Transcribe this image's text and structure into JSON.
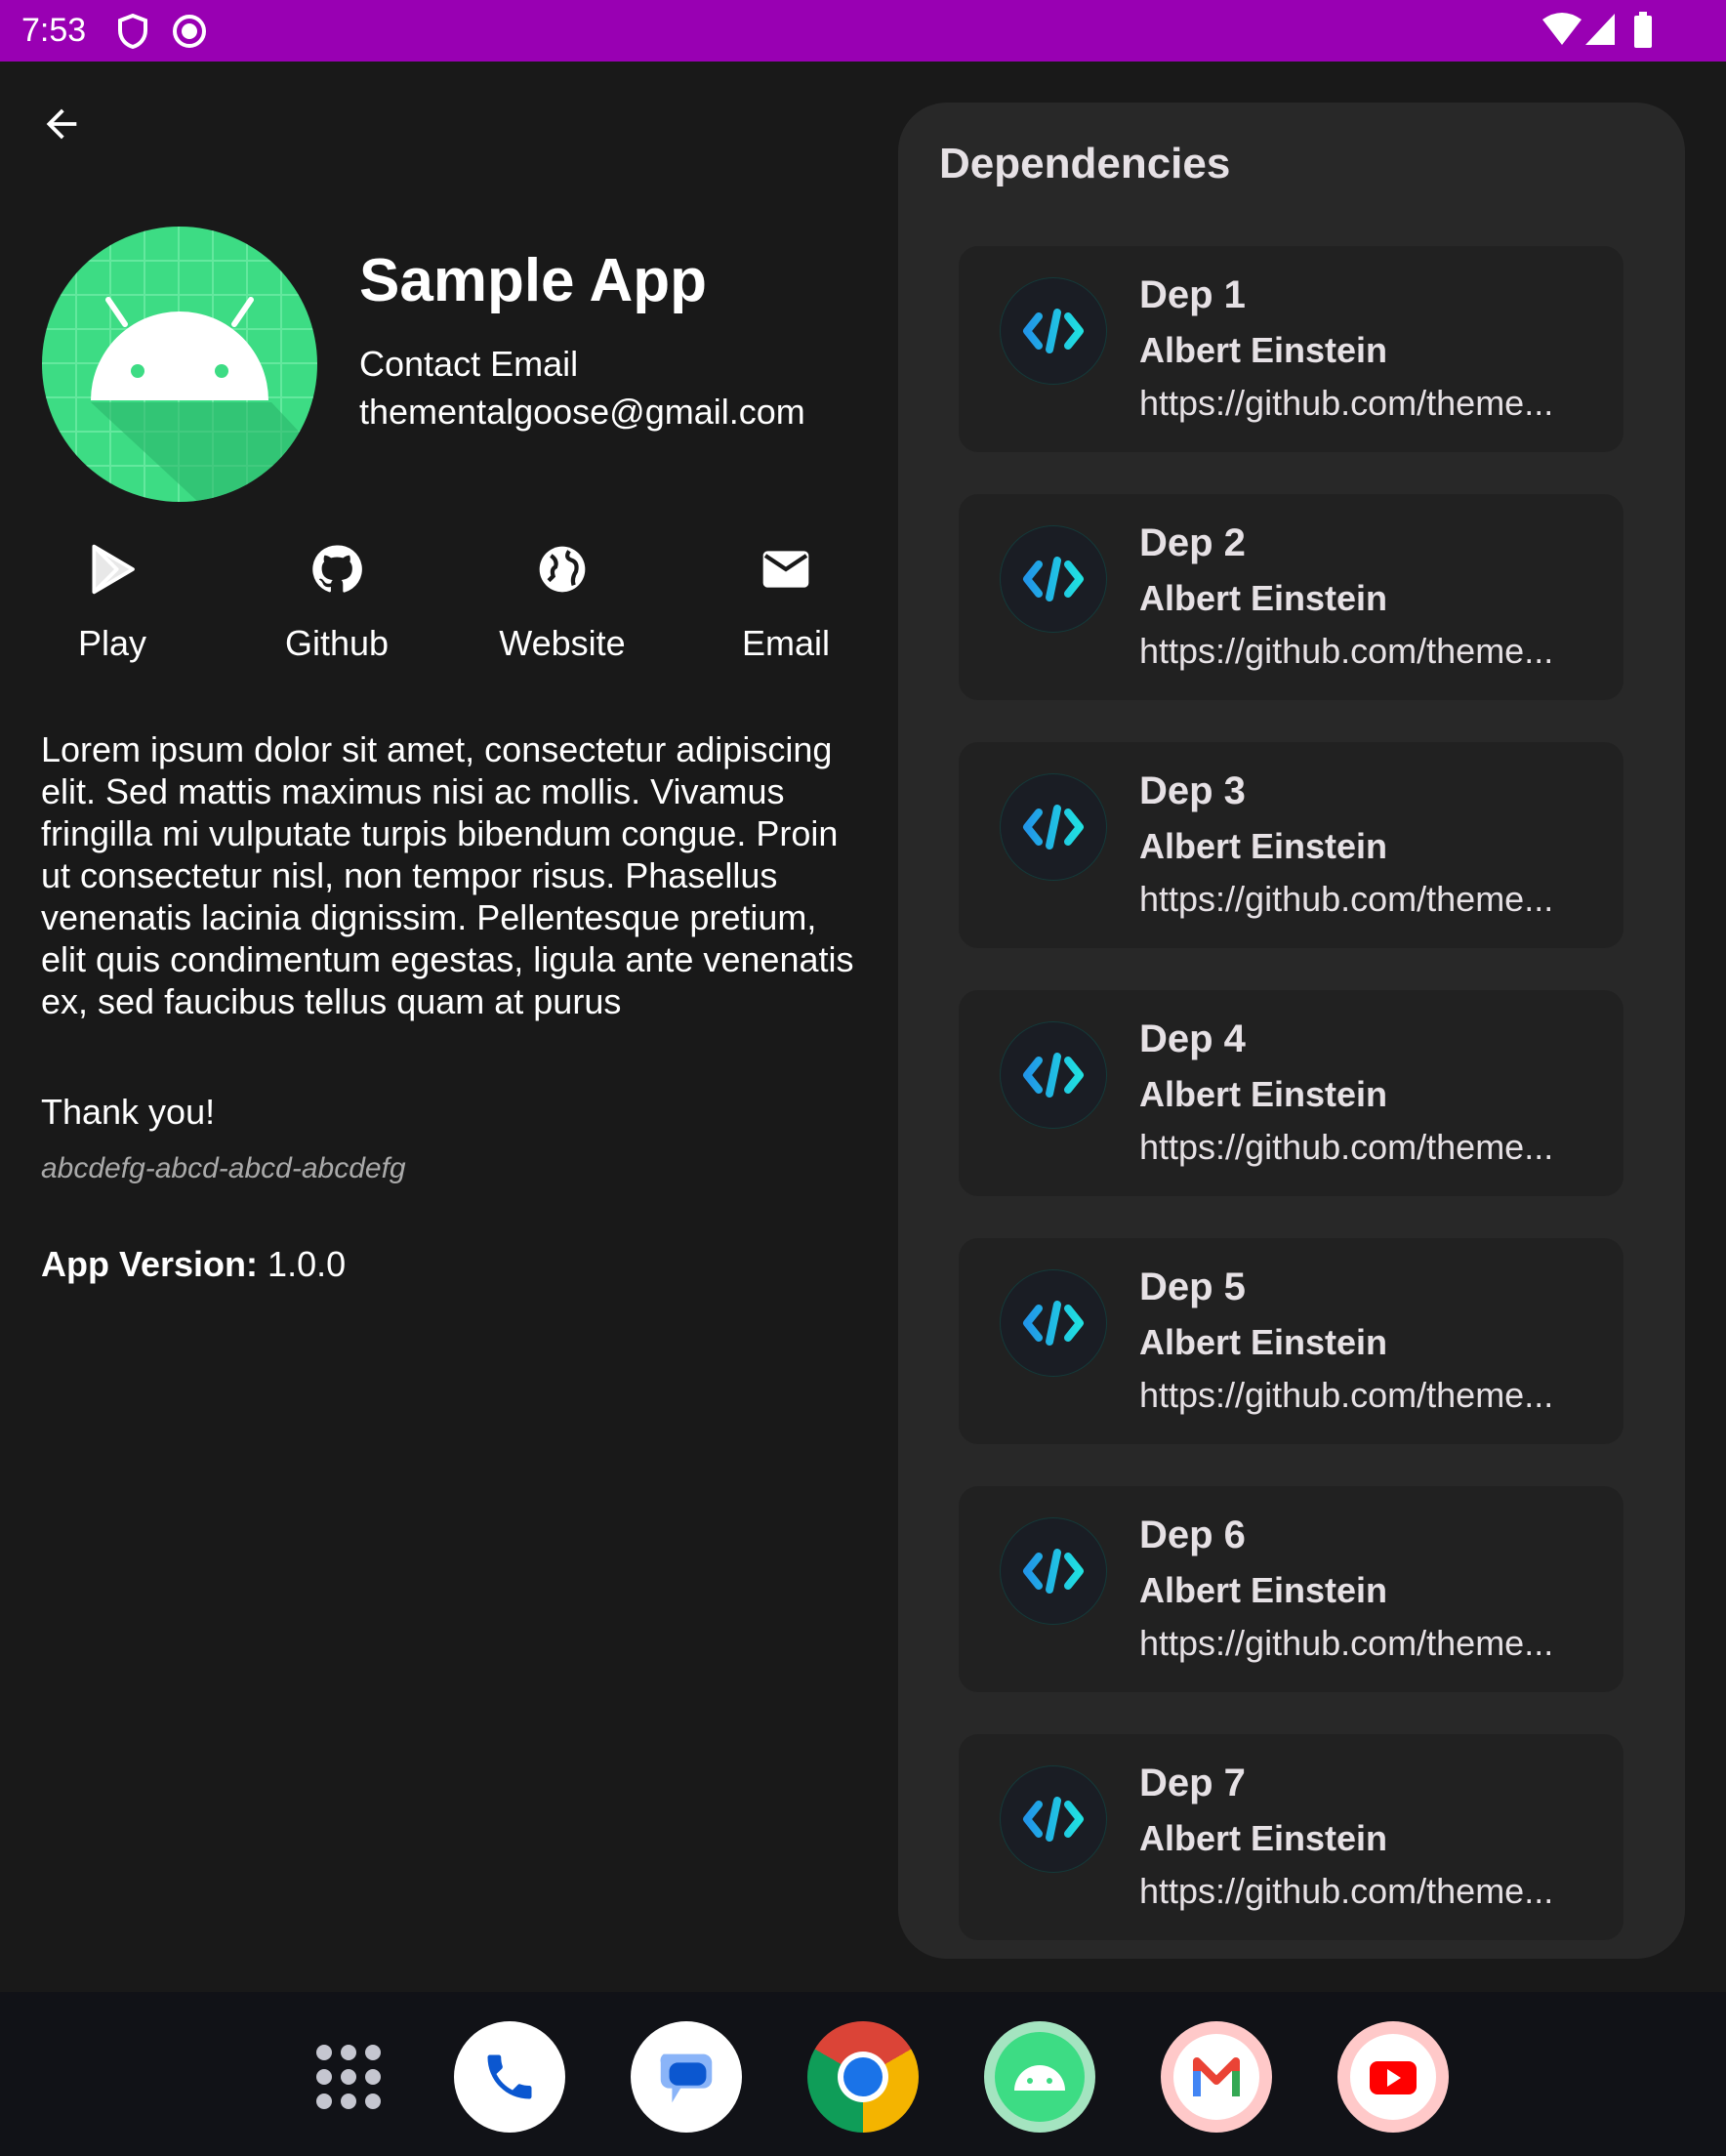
{
  "status_bar": {
    "time": "7:53",
    "color": "#9900b3"
  },
  "header": {
    "back_icon": "arrow-back-icon"
  },
  "app": {
    "name": "Sample App",
    "contact_label": "Contact Email",
    "contact_email": "thementalgoose@gmail.com",
    "actions": [
      {
        "label": "Play",
        "icon": "play-store-icon"
      },
      {
        "label": "Github",
        "icon": "github-icon"
      },
      {
        "label": "Website",
        "icon": "globe-icon"
      },
      {
        "label": "Email",
        "icon": "email-icon"
      }
    ],
    "description": "Lorem ipsum dolor sit amet, consectetur adipiscing elit. Sed mattis maximus nisi ac mollis. Vivamus fringilla mi vulputate turpis bibendum congue. Proin ut consectetur nisl, non tempor risus. Phasellus venenatis lacinia dignissim. Pellentesque pretium, elit quis condimentum egestas, ligula ante venenatis ex, sed faucibus tellus quam at purus",
    "thanks": "Thank you!",
    "install_id": "abcdefg-abcd-abcd-abcdefg",
    "version_label": "App Version:",
    "version": "1.0.0"
  },
  "dependencies": {
    "title": "Dependencies",
    "items": [
      {
        "name": "Dep 1",
        "author": "Albert Einstein",
        "url": "https://github.com/theme..."
      },
      {
        "name": "Dep 2",
        "author": "Albert Einstein",
        "url": "https://github.com/theme..."
      },
      {
        "name": "Dep 3",
        "author": "Albert Einstein",
        "url": "https://github.com/theme..."
      },
      {
        "name": "Dep 4",
        "author": "Albert Einstein",
        "url": "https://github.com/theme..."
      },
      {
        "name": "Dep 5",
        "author": "Albert Einstein",
        "url": "https://github.com/theme..."
      },
      {
        "name": "Dep 6",
        "author": "Albert Einstein",
        "url": "https://github.com/theme..."
      },
      {
        "name": "Dep 7",
        "author": "Albert Einstein",
        "url": "https://github.com/theme..."
      }
    ]
  },
  "nav_bar": {
    "apps": [
      "app-drawer-icon",
      "phone-icon",
      "messages-icon",
      "chrome-icon",
      "sample-app-icon",
      "gmail-icon",
      "youtube-icon"
    ]
  }
}
